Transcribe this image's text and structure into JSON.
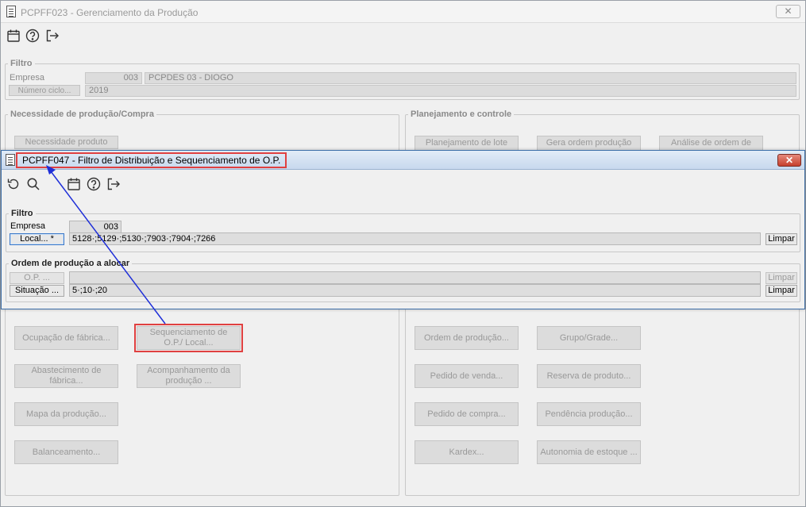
{
  "main_window": {
    "title": "PCPFF023 - Gerenciamento da Produção",
    "close_label": "✕",
    "toolbar": {
      "icons": [
        "calendar-icon",
        "help-icon",
        "exit-icon"
      ]
    },
    "filter": {
      "legend": "Filtro",
      "empresa_label": "Empresa",
      "empresa_code": "003",
      "empresa_name": "PCPDES 03 - DIOGO",
      "ciclo_button": "Número ciclo...",
      "ciclo_value": "2019"
    },
    "necessidade": {
      "legend": "Necessidade de produção/Compra",
      "buttons": {
        "necessidade_produto": "Necessidade produto",
        "ocupacao_fabrica": "Ocupação de fábrica...",
        "sequenciamento": "Sequenciamento de O.P./ Local...",
        "abastecimento": "Abastecimento de fábrica...",
        "acompanhamento": "Acompanhamento da produção ...",
        "mapa_producao": "Mapa da produção...",
        "balanceamento": "Balanceamento..."
      }
    },
    "planejamento": {
      "legend": "Planejamento e controle",
      "buttons": {
        "planejamento_lote": "Planejamento de lote",
        "gera_ordem": "Gera ordem produção",
        "analise_ordem": "Análise de ordem de",
        "ordem_producao": "Ordem de produção...",
        "grupo_grade": "Grupo/Grade...",
        "pedido_venda": "Pedido de venda...",
        "reserva_produto": "Reserva de produto...",
        "pedido_compra": "Pedido de compra...",
        "pendencia_producao": "Pendência produção...",
        "kardex": "Kardex...",
        "autonomia_estoque": "Autonomia de estoque ..."
      }
    }
  },
  "dialog": {
    "title": "PCPFF047 - Filtro de Distribuição e Sequenciamento de O.P.",
    "close_label": "✕",
    "toolbar": {
      "icons": [
        "undo-icon",
        "search-icon",
        "calendar-icon",
        "help-icon",
        "exit-icon"
      ]
    },
    "filter": {
      "legend": "Filtro",
      "empresa_label": "Empresa",
      "empresa_value": "003",
      "local_button": "Local... *",
      "local_value": "5128·;5129·;5130·;7903·;7904·;7266",
      "limpar_label": "Limpar"
    },
    "ordem": {
      "legend": "Ordem de produção a alocar",
      "op_button": "O.P. ...",
      "op_value": "",
      "op_limpar": "Limpar",
      "situacao_button": "Situação ...",
      "situacao_value": "5·;10·;20",
      "situacao_limpar": "Limpar"
    }
  },
  "colors": {
    "annotation_red": "#e04040",
    "arrow_blue": "#1f2fd8"
  }
}
